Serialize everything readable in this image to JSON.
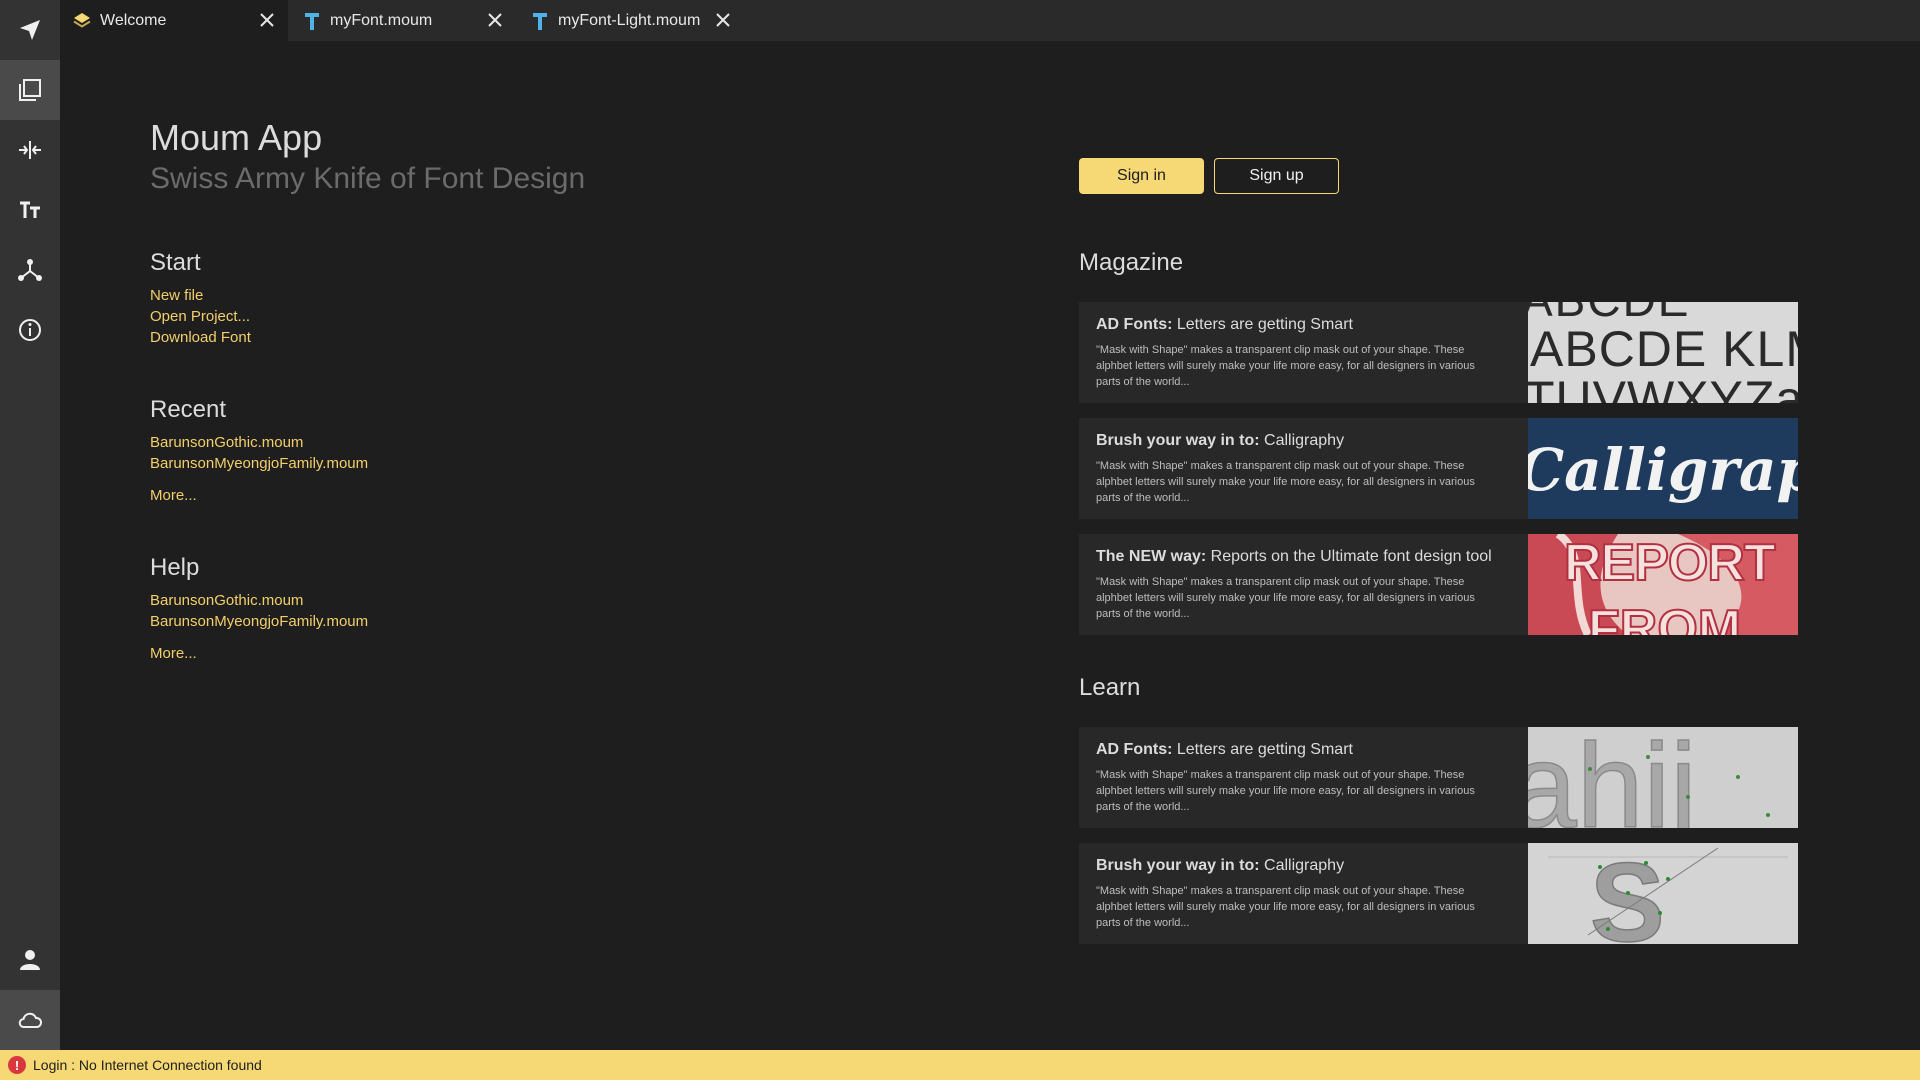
{
  "tabs": [
    {
      "label": "Welcome",
      "icon": "layers-icon"
    },
    {
      "label": "myFont.moum",
      "icon": "font-file-icon"
    },
    {
      "label": "myFont-Light.moum",
      "icon": "font-file-icon"
    }
  ],
  "sidebar": {
    "items": [
      "navigate-icon",
      "pages-icon",
      "compare-icon",
      "text-size-icon",
      "network-icon",
      "info-icon"
    ],
    "bottom": [
      "user-icon",
      "cloud-icon"
    ]
  },
  "header": {
    "title": "Moum App",
    "subtitle": "Swiss Army Knife of Font Design"
  },
  "start": {
    "title": "Start",
    "links": [
      "New file",
      "Open Project...",
      "Download Font"
    ]
  },
  "recent": {
    "title": "Recent",
    "links": [
      "BarunsonGothic.moum",
      "BarunsonMyeongjoFamily.moum"
    ],
    "more": "More..."
  },
  "help": {
    "title": "Help",
    "links": [
      "BarunsonGothic.moum",
      "BarunsonMyeongjoFamily.moum"
    ],
    "more": "More..."
  },
  "auth": {
    "signin": "Sign in",
    "signup": "Sign up"
  },
  "magazine": {
    "title": "Magazine",
    "cards": [
      {
        "title_bold": "AD Fonts:",
        "title_rest": " Letters are getting Smart",
        "desc": "\"Mask with Shape\" makes a transparent clip mask out of your shape. These alphbet letters will surely make your life more easy, for all designers in various parts of the world...",
        "thumb_text": "ABCDE KLMNOPQR TUVWXYZa"
      },
      {
        "title_bold": "Brush your way in to:",
        "title_rest": " Calligraphy",
        "desc": "\"Mask with Shape\" makes a transparent clip mask out of your shape. These alphbet letters will surely make your life more easy, for all designers in various parts of the world...",
        "thumb_text": "Calligraphy"
      },
      {
        "title_bold": "The NEW way:",
        "title_rest": " Reports on the Ultimate font design tool",
        "desc": "\"Mask with Shape\" makes a transparent clip mask out of your shape. These alphbet letters will surely make your life more easy, for all designers in various parts of the world...",
        "thumb_text": "REPORT FROM"
      }
    ]
  },
  "learn": {
    "title": "Learn",
    "cards": [
      {
        "title_bold": "AD Fonts:",
        "title_rest": " Letters are getting Smart",
        "desc": "\"Mask with Shape\" makes a transparent clip mask out of your shape. These alphbet letters will surely make your life more easy, for all designers in various parts of the world...",
        "thumb_text": "ahij"
      },
      {
        "title_bold": "Brush your way in to:",
        "title_rest": " Calligraphy",
        "desc": "\"Mask with Shape\" makes a transparent clip mask out of your shape. These alphbet letters will surely make your life more easy, for all designers in various parts of the world...",
        "thumb_text": "S"
      }
    ]
  },
  "status": {
    "icon": "error-icon",
    "text": "Login : No Internet Connection found"
  },
  "colors": {
    "accent": "#f6d875",
    "link": "#f2cf6a",
    "background": "#1e1e1e",
    "sidebar": "#333333",
    "tab_icon": "#4fb3ea"
  }
}
